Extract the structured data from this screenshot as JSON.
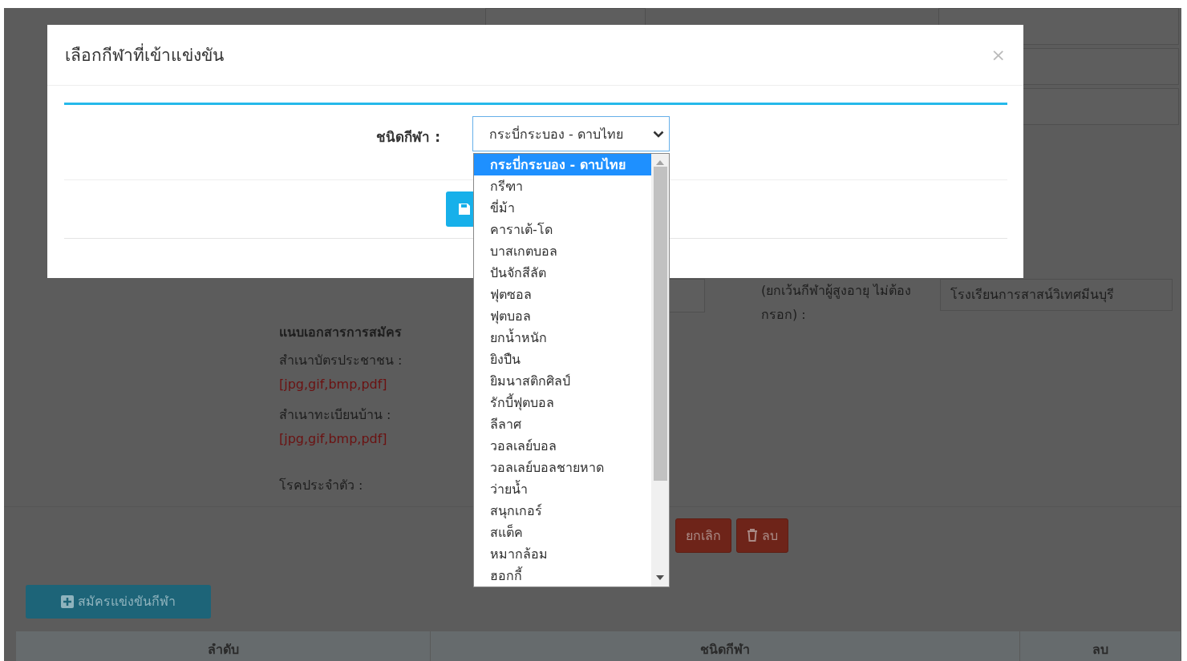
{
  "background_form": {
    "school_label": "(ยกเว้นกีฬาผู้สูงอายุ ไม่ต้องกรอก) :",
    "school_value": "โรงเรียนการสาสน์วิเทศมีนบุรี",
    "attachments_heading": "แนบเอกสารการสมัคร",
    "attachments": [
      {
        "label": "สำเนาบัตรประชาชน :",
        "formats": "[jpg,gif,bmp,pdf]"
      },
      {
        "label": "สำเนาทะเบียนบ้าน :",
        "formats": "[jpg,gif,bmp,pdf]"
      }
    ],
    "disease_label": "โรคประจำตัว :",
    "buttons": [
      {
        "kind": "cancel",
        "label": "ยกเลิก"
      },
      {
        "kind": "delete",
        "label": "ลบ"
      }
    ]
  },
  "register_button": "สมัครแข่งขันกีฬา",
  "table": {
    "columns": [
      "ลำดับ",
      "ชนิดกีฬา",
      "ลบ"
    ]
  },
  "modal": {
    "title": "เลือกกีฬาที่เข้าแข่งขัน",
    "close": "×",
    "sport_label": "ชนิดกีฬา :",
    "sport_select": {
      "value": "กระบี่กระบอง - ดาบไทย",
      "expanded": true,
      "options": [
        {
          "label": "กระบี่กระบอง - ดาบไทย",
          "selected": true
        },
        {
          "label": "กรีฑา",
          "selected": false
        },
        {
          "label": "ขี่ม้า",
          "selected": false
        },
        {
          "label": "คาราเต้-โด",
          "selected": false
        },
        {
          "label": "บาสเกตบอล",
          "selected": false
        },
        {
          "label": "ปันจักสีลัต",
          "selected": false
        },
        {
          "label": "ฟุตซอล",
          "selected": false
        },
        {
          "label": "ฟุตบอล",
          "selected": false
        },
        {
          "label": "ยกน้ำหนัก",
          "selected": false
        },
        {
          "label": "ยิงปืน",
          "selected": false
        },
        {
          "label": "ยิมนาสติกศิลป์",
          "selected": false
        },
        {
          "label": "รักบี้ฟุตบอล",
          "selected": false
        },
        {
          "label": "ลีลาศ",
          "selected": false
        },
        {
          "label": "วอลเลย์บอล",
          "selected": false
        },
        {
          "label": "วอลเลย์บอลชายหาด",
          "selected": false
        },
        {
          "label": "ว่ายน้ำ",
          "selected": false
        },
        {
          "label": "สนุกเกอร์",
          "selected": false
        },
        {
          "label": "สแต็ค",
          "selected": false
        },
        {
          "label": "หมากล้อม",
          "selected": false
        },
        {
          "label": "ฮอกกี้",
          "selected": false
        }
      ]
    }
  }
}
